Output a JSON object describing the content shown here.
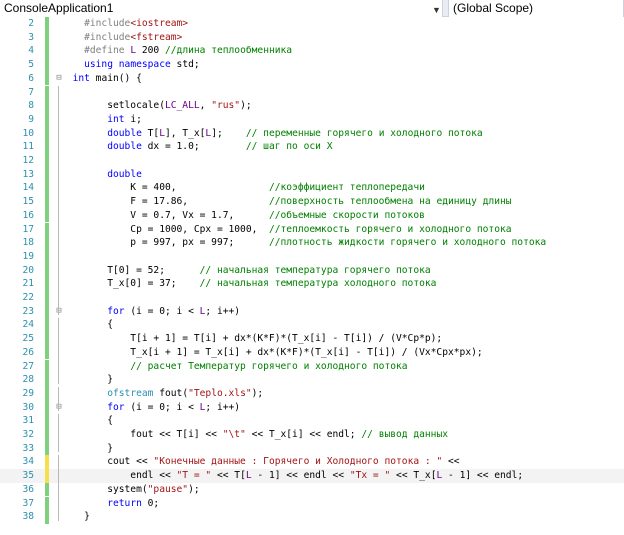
{
  "navbar": {
    "project": "ConsoleApplication1",
    "scope": "(Global Scope)"
  },
  "lines": [
    {
      "n": "2",
      "mark": "saved",
      "fold": "",
      "tokens": [
        {
          "t": "    "
        },
        {
          "t": "#include",
          "c": "pp"
        },
        {
          "t": "<iostream>",
          "c": "str"
        }
      ]
    },
    {
      "n": "3",
      "mark": "saved",
      "fold": "",
      "tokens": [
        {
          "t": "    "
        },
        {
          "t": "#include",
          "c": "pp"
        },
        {
          "t": "<fstream>",
          "c": "str"
        }
      ]
    },
    {
      "n": "4",
      "mark": "saved",
      "fold": "",
      "tokens": [
        {
          "t": "    "
        },
        {
          "t": "#define",
          "c": "pp"
        },
        {
          "t": " "
        },
        {
          "t": "L",
          "c": "mac"
        },
        {
          "t": " 200 "
        },
        {
          "t": "//длина теплообменника",
          "c": "cm"
        }
      ]
    },
    {
      "n": "5",
      "mark": "saved",
      "fold": "",
      "tokens": [
        {
          "t": "    "
        },
        {
          "t": "using",
          "c": "kw"
        },
        {
          "t": " "
        },
        {
          "t": "namespace",
          "c": "kw"
        },
        {
          "t": " std;"
        }
      ]
    },
    {
      "n": "6",
      "mark": "saved",
      "fold": "minus",
      "tokens": [
        {
          "t": "  "
        },
        {
          "t": "int",
          "c": "kw"
        },
        {
          "t": " main() {"
        }
      ]
    },
    {
      "n": "7",
      "mark": "saved",
      "fold": "",
      "tokens": [
        {
          "t": ""
        }
      ]
    },
    {
      "n": "8",
      "mark": "saved",
      "fold": "",
      "tokens": [
        {
          "t": "        setlocale("
        },
        {
          "t": "LC_ALL",
          "c": "mac"
        },
        {
          "t": ", "
        },
        {
          "t": "\"rus\"",
          "c": "str"
        },
        {
          "t": ");"
        }
      ]
    },
    {
      "n": "9",
      "mark": "saved",
      "fold": "",
      "tokens": [
        {
          "t": "        "
        },
        {
          "t": "int",
          "c": "kw"
        },
        {
          "t": " i;"
        }
      ]
    },
    {
      "n": "10",
      "mark": "saved",
      "fold": "",
      "tokens": [
        {
          "t": "        "
        },
        {
          "t": "double",
          "c": "kw"
        },
        {
          "t": " T["
        },
        {
          "t": "L",
          "c": "mac"
        },
        {
          "t": "], T_x["
        },
        {
          "t": "L",
          "c": "mac"
        },
        {
          "t": "];    "
        },
        {
          "t": "// переменные горячего и холодного потока",
          "c": "cm"
        }
      ]
    },
    {
      "n": "11",
      "mark": "saved",
      "fold": "",
      "tokens": [
        {
          "t": "        "
        },
        {
          "t": "double",
          "c": "kw"
        },
        {
          "t": " dx = 1.0;        "
        },
        {
          "t": "// шаг по оси X",
          "c": "cm"
        }
      ]
    },
    {
      "n": "12",
      "mark": "saved",
      "fold": "",
      "tokens": [
        {
          "t": ""
        }
      ]
    },
    {
      "n": "13",
      "mark": "saved",
      "fold": "",
      "tokens": [
        {
          "t": "        "
        },
        {
          "t": "double",
          "c": "kw"
        }
      ]
    },
    {
      "n": "14",
      "mark": "saved",
      "fold": "",
      "tokens": [
        {
          "t": "            K = 400,                "
        },
        {
          "t": "//коэффициент теплопередачи",
          "c": "cm"
        }
      ]
    },
    {
      "n": "15",
      "mark": "saved",
      "fold": "",
      "tokens": [
        {
          "t": "            F = 17.86,              "
        },
        {
          "t": "//поверхность теплообмена на единицу длины",
          "c": "cm"
        }
      ]
    },
    {
      "n": "16",
      "mark": "saved",
      "fold": "",
      "tokens": [
        {
          "t": "            V = 0.7, Vx = 1.7,      "
        },
        {
          "t": "//объемные скорости потоков",
          "c": "cm"
        }
      ]
    },
    {
      "n": "17",
      "mark": "saved",
      "fold": "",
      "tokens": [
        {
          "t": "            Cp = 1000, Cpx = 1000,  "
        },
        {
          "t": "//теплоемкость горячего и холодного потока",
          "c": "cm"
        }
      ]
    },
    {
      "n": "18",
      "mark": "saved",
      "fold": "",
      "tokens": [
        {
          "t": "            p = 997, px = 997;      "
        },
        {
          "t": "//плотность жидкости горячего и холодного потока",
          "c": "cm"
        }
      ]
    },
    {
      "n": "19",
      "mark": "saved",
      "fold": "",
      "tokens": [
        {
          "t": ""
        }
      ]
    },
    {
      "n": "20",
      "mark": "saved",
      "fold": "",
      "tokens": [
        {
          "t": "        T[0] = 52;      "
        },
        {
          "t": "// начальная температура горячего потока",
          "c": "cm"
        }
      ]
    },
    {
      "n": "21",
      "mark": "saved",
      "fold": "",
      "tokens": [
        {
          "t": "        T_x[0] = 37;    "
        },
        {
          "t": "// начальная температура холодного потока",
          "c": "cm"
        }
      ]
    },
    {
      "n": "22",
      "mark": "saved",
      "fold": "",
      "tokens": [
        {
          "t": ""
        }
      ]
    },
    {
      "n": "23",
      "mark": "saved",
      "fold": "minus",
      "tokens": [
        {
          "t": "        "
        },
        {
          "t": "for",
          "c": "kw"
        },
        {
          "t": " (i = 0; i < "
        },
        {
          "t": "L",
          "c": "mac"
        },
        {
          "t": "; i++)"
        }
      ]
    },
    {
      "n": "24",
      "mark": "saved",
      "fold": "",
      "tokens": [
        {
          "t": "        {"
        }
      ]
    },
    {
      "n": "25",
      "mark": "saved",
      "fold": "",
      "tokens": [
        {
          "t": "            T[i + 1] = T[i] + dx*(K*F)*(T_x[i] - T[i]) / (V*Cp*p);"
        }
      ]
    },
    {
      "n": "26",
      "mark": "saved",
      "fold": "",
      "tokens": [
        {
          "t": "            T_x[i + 1] = T_x[i] + dx*(K*F)*(T_x[i] - T[i]) / (Vx*Cpx*px);"
        }
      ]
    },
    {
      "n": "27",
      "mark": "saved",
      "fold": "",
      "tokens": [
        {
          "t": "            "
        },
        {
          "t": "// расчет Температур горячего и холодного потока",
          "c": "cm"
        }
      ]
    },
    {
      "n": "28",
      "mark": "saved",
      "fold": "",
      "tokens": [
        {
          "t": "        }"
        }
      ]
    },
    {
      "n": "29",
      "mark": "saved",
      "fold": "",
      "tokens": [
        {
          "t": "        "
        },
        {
          "t": "ofstream",
          "c": "ty"
        },
        {
          "t": " fout("
        },
        {
          "t": "\"Teplo.xls\"",
          "c": "str"
        },
        {
          "t": ");"
        }
      ]
    },
    {
      "n": "30",
      "mark": "saved",
      "fold": "minus",
      "tokens": [
        {
          "t": "        "
        },
        {
          "t": "for",
          "c": "kw"
        },
        {
          "t": " (i = 0; i < "
        },
        {
          "t": "L",
          "c": "mac"
        },
        {
          "t": "; i++)"
        }
      ]
    },
    {
      "n": "31",
      "mark": "saved",
      "fold": "",
      "tokens": [
        {
          "t": "        {"
        }
      ]
    },
    {
      "n": "32",
      "mark": "saved",
      "fold": "",
      "tokens": [
        {
          "t": "            fout << T[i] << "
        },
        {
          "t": "\"\\t\"",
          "c": "str"
        },
        {
          "t": " << T_x[i] << endl; "
        },
        {
          "t": "// вывод данных",
          "c": "cm"
        }
      ]
    },
    {
      "n": "33",
      "mark": "saved",
      "fold": "",
      "tokens": [
        {
          "t": "        }"
        }
      ]
    },
    {
      "n": "34",
      "mark": "unsaved",
      "fold": "",
      "tokens": [
        {
          "t": "        cout << "
        },
        {
          "t": "\"Конечные данные : Горячего и Холодного потока : \"",
          "c": "str"
        },
        {
          "t": " <<"
        }
      ]
    },
    {
      "n": "35",
      "mark": "unsaved",
      "fold": "",
      "current": true,
      "tokens": [
        {
          "t": "            endl << "
        },
        {
          "t": "\"T = \"",
          "c": "str"
        },
        {
          "t": " << T["
        },
        {
          "t": "L",
          "c": "mac"
        },
        {
          "t": " - 1] << endl << "
        },
        {
          "t": "\"Tx = \"",
          "c": "str"
        },
        {
          "t": " << T_x["
        },
        {
          "t": "L",
          "c": "mac"
        },
        {
          "t": " - 1] << endl;"
        }
      ]
    },
    {
      "n": "36",
      "mark": "saved",
      "fold": "",
      "tokens": [
        {
          "t": "        system("
        },
        {
          "t": "\"pause\"",
          "c": "str"
        },
        {
          "t": ");"
        }
      ]
    },
    {
      "n": "37",
      "mark": "saved",
      "fold": "",
      "tokens": [
        {
          "t": "        "
        },
        {
          "t": "return",
          "c": "kw"
        },
        {
          "t": " 0;"
        }
      ]
    },
    {
      "n": "38",
      "mark": "saved",
      "fold": "",
      "tokens": [
        {
          "t": "    }"
        }
      ]
    }
  ]
}
